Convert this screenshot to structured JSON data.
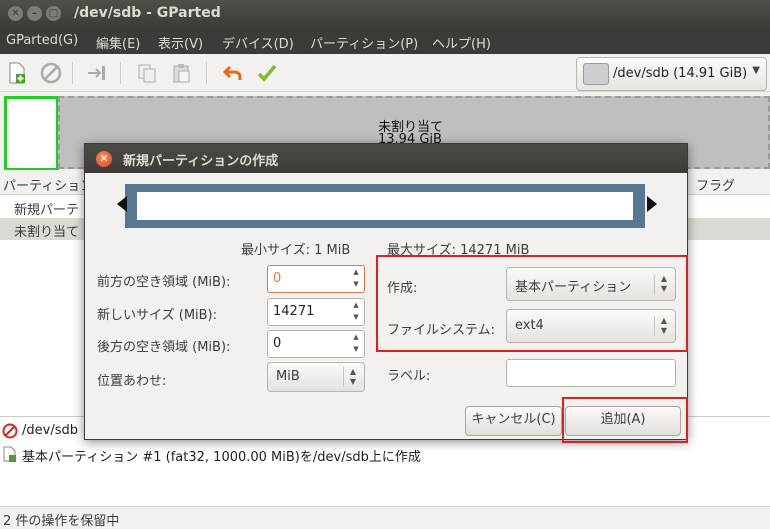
{
  "window": {
    "title": "/dev/sdb - GParted"
  },
  "menubar": {
    "items": [
      "GParted(G)",
      "編集(E)",
      "表示(V)",
      "デバイス(D)",
      "パーティション(P)",
      "ヘルプ(H)"
    ]
  },
  "toolbar": {
    "device": "/dev/sdb  (14.91 GiB)"
  },
  "disk_graph": {
    "unallocated_label": "未割り当て",
    "unallocated_size": "13.94 GiB"
  },
  "partition_list": {
    "col_partition": "パーティション",
    "col_flags": "フラグ",
    "rows": [
      "新規パーテ",
      "未割り当て"
    ]
  },
  "operations": {
    "items": [
      "/dev/sdb",
      "基本パーティション #1 (fat32, 1000.00 MiB)を/dev/sdb上に作成"
    ]
  },
  "status": {
    "text": "2 件の操作を保留中"
  },
  "dialog": {
    "title": "新規パーティションの作成",
    "min_size": "最小サイズ: 1 MiB",
    "max_size": "最大サイズ: 14271 MiB",
    "free_before_label": "前方の空き領域 (MiB):",
    "free_before_value": "0",
    "new_size_label": "新しいサイズ (MiB):",
    "new_size_value": "14271",
    "free_after_label": "後方の空き領域 (MiB):",
    "free_after_value": "0",
    "align_label": "位置あわせ:",
    "align_value": "MiB",
    "create_as_label": "作成:",
    "create_as_value": "基本パーティション",
    "filesystem_label": "ファイルシステム:",
    "filesystem_value": "ext4",
    "label_label": "ラベル:",
    "label_value": "",
    "cancel_button": "キャンセル(C)",
    "add_button": "追加(A)"
  },
  "colors": {
    "new_partition_border": "#1dd11d",
    "highlight_box": "#e0201d",
    "resizer_bar": "#5a7791",
    "title_bar": "#3c3b37"
  }
}
